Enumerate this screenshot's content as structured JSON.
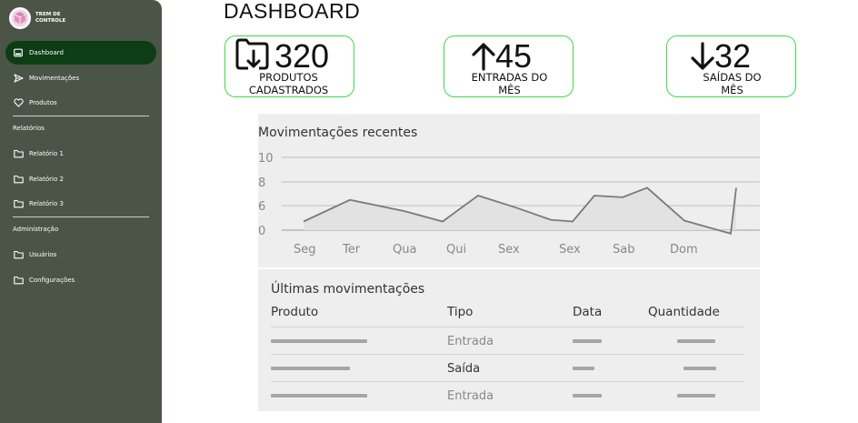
{
  "brand": {
    "name_line1": "TREM DE",
    "name_line2": "CONTROLE"
  },
  "sidebar": {
    "items": [
      {
        "label": "Dashboard"
      },
      {
        "label": "Movimentações"
      },
      {
        "label": "Produtos"
      }
    ],
    "section_reports": "Relatórios",
    "reports": [
      {
        "label": "Relatório 1"
      },
      {
        "label": "Relatório 2"
      },
      {
        "label": "Relatório 3"
      }
    ],
    "section_admin": "Administração",
    "admin": [
      {
        "label": "Usuários"
      },
      {
        "label": "Configurações"
      }
    ],
    "colors": {
      "background": "#4a5547",
      "active": "#0c3d14"
    }
  },
  "page": {
    "title": "DASHBOARD"
  },
  "cards": [
    {
      "value": "320",
      "label_line1": "PRODUTOS",
      "label_line2": "CADASTRADOS",
      "icon": "folder-download-icon"
    },
    {
      "value": "45",
      "label_line1": "ENTRADAS DO",
      "label_line2": "MÊS",
      "icon": "arrow-up-icon"
    },
    {
      "value": "32",
      "label_line1": "SAÍDAS DO",
      "label_line2": "MÊS",
      "icon": "arrow-down-icon"
    }
  ],
  "chart_data": {
    "type": "area",
    "title": "Movimentações recentes",
    "categories": [
      "Seg",
      "Ter",
      "Qua",
      "Qui",
      "Sex",
      "Sex",
      "Sab",
      "Dom"
    ],
    "x": [
      0,
      0.5,
      1,
      1.5,
      2,
      2.5,
      3,
      3.5,
      4,
      4.5,
      5,
      5.5,
      6,
      6.5,
      7,
      7.5,
      8
    ],
    "values": [
      1,
      3.5,
      2.2,
      1,
      4,
      2.6,
      1.2,
      1,
      4,
      3.8,
      4.9,
      1.1,
      -0.4,
      4.9
    ],
    "yticks": [
      0,
      6,
      8,
      10
    ],
    "ylim": [
      0,
      10
    ],
    "grid": true,
    "colors": {
      "line": "#7a7a7a",
      "fill": "#e2e2e2"
    }
  },
  "table": {
    "title": "Últimas movimentações",
    "headers": [
      "Produto",
      "Tipo",
      "Data",
      "Quantidade"
    ],
    "rows": [
      {
        "tipo": "Entrada"
      },
      {
        "tipo": "Saída"
      },
      {
        "tipo": "Entrada"
      }
    ]
  },
  "accent": "#3fd94a"
}
